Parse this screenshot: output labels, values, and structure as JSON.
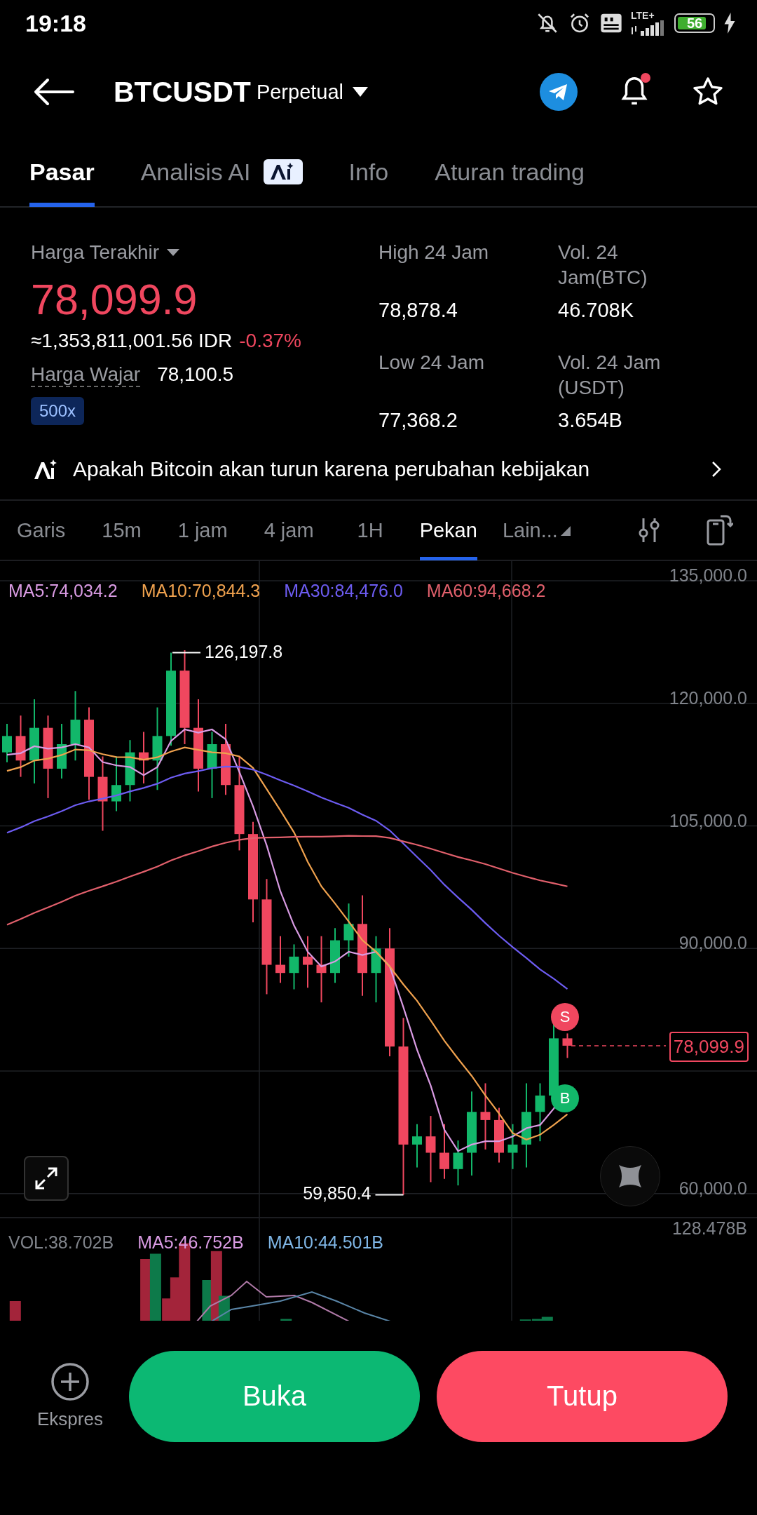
{
  "status_bar": {
    "time": "19:18",
    "network": "LTE+",
    "battery": "56"
  },
  "header": {
    "symbol": "BTCUSDT",
    "contract": "Perpetual",
    "alert_dot": true
  },
  "tabs": [
    {
      "label": "Pasar",
      "selected": true,
      "badge": false
    },
    {
      "label": "Analisis AI",
      "selected": false,
      "badge": true
    },
    {
      "label": "Info",
      "selected": false,
      "badge": false
    },
    {
      "label": "Aturan trading",
      "selected": false,
      "badge": false
    }
  ],
  "stats": {
    "last_price_label": "Harga Terakhir",
    "last_price": "78,099.9",
    "idr_value": "≈1,353,811,001.56 IDR",
    "change": "-0.37%",
    "fair_price_label": "Harga Wajar",
    "fair_price": "78,100.5",
    "leverage": "500x",
    "cells": [
      {
        "label": "High 24 Jam",
        "value": "78,878.4"
      },
      {
        "label": "Vol. 24 Jam(BTC)",
        "value": "46.708K"
      },
      {
        "label": "Low 24 Jam",
        "value": "77,368.2"
      },
      {
        "label": "Vol. 24 Jam (USDT)",
        "value": "3.654B"
      }
    ]
  },
  "ai_insight": "Apakah Bitcoin akan turun karena perubahan kebijakan",
  "timeframes": [
    {
      "label": "Garis",
      "selected": false,
      "kind": "option"
    },
    {
      "label": "15m",
      "selected": false,
      "kind": "option"
    },
    {
      "label": "1 jam",
      "selected": false,
      "kind": "option"
    },
    {
      "label": "4 jam",
      "selected": false,
      "kind": "option"
    },
    {
      "label": "1H",
      "selected": false,
      "kind": "option"
    },
    {
      "label": "Pekan",
      "selected": true,
      "kind": "option"
    },
    {
      "label": "Lain...",
      "selected": false,
      "kind": "dropdown"
    }
  ],
  "chart": {
    "ma": [
      {
        "label": "MA5:74,034.2",
        "color": "#d99be3"
      },
      {
        "label": "MA10:70,844.3",
        "color": "#f0a24e"
      },
      {
        "label": "MA30:84,476.0",
        "color": "#6d5cf2"
      },
      {
        "label": "MA60:94,668.2",
        "color": "#e2606c"
      }
    ],
    "price_axis": [
      "135,000.0",
      "120,000.0",
      "105,000.0",
      "90,000.0",
      "60,000.0"
    ],
    "high_marker": "126,197.8",
    "low_marker": "59,850.4",
    "last_price_tag": "78,099.9",
    "signals": [
      {
        "label": "S",
        "kind": "sell"
      },
      {
        "label": "B",
        "kind": "buy"
      }
    ]
  },
  "volume": {
    "labels": [
      {
        "text": "VOL:38.702B",
        "color": "#80848b"
      },
      {
        "text": "MA5:46.752B",
        "color": "#d99be3"
      },
      {
        "text": "MA10:44.501B",
        "color": "#7fb6e6"
      }
    ],
    "axis_max": "128.478B"
  },
  "actions": {
    "express": "Ekspres",
    "buttons": [
      {
        "label": "Buka",
        "kind": "open"
      },
      {
        "label": "Tutup",
        "kind": "close"
      }
    ]
  }
}
